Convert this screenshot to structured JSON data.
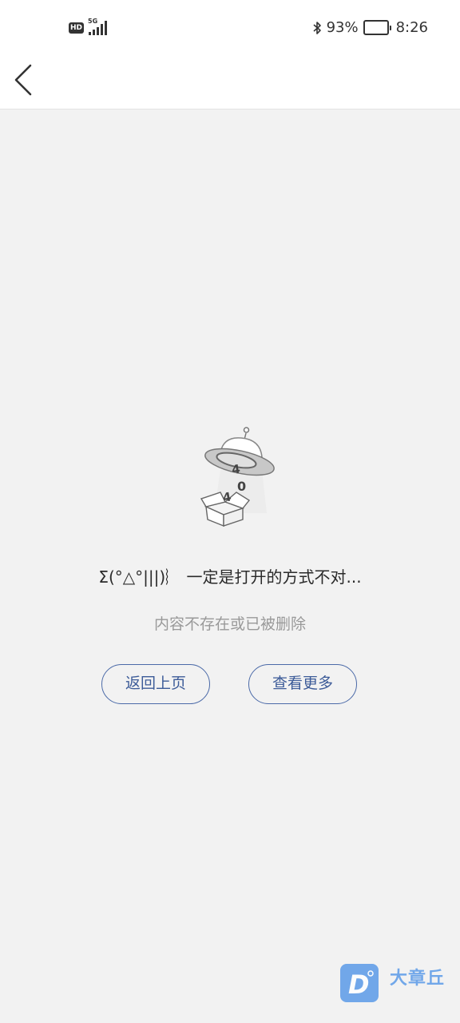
{
  "status_bar": {
    "network_badge": "HD",
    "network_type": "5G",
    "battery_level": "93%",
    "battery_fraction": 0.93,
    "time": "8:26"
  },
  "illustration": {
    "digits": [
      "4",
      "0",
      "4"
    ]
  },
  "error": {
    "title": "Σ(°△°|||)︴ 一定是打开的方式不对...",
    "subtitle": "内容不存在或已被删除"
  },
  "buttons": {
    "back_label": "返回上页",
    "more_label": "查看更多"
  },
  "watermark": {
    "logo_letter": "D",
    "text": "大章丘"
  },
  "colors": {
    "accent": "#4b6aa8",
    "background": "#f2f2f2",
    "watermark": "#5b9be8"
  }
}
